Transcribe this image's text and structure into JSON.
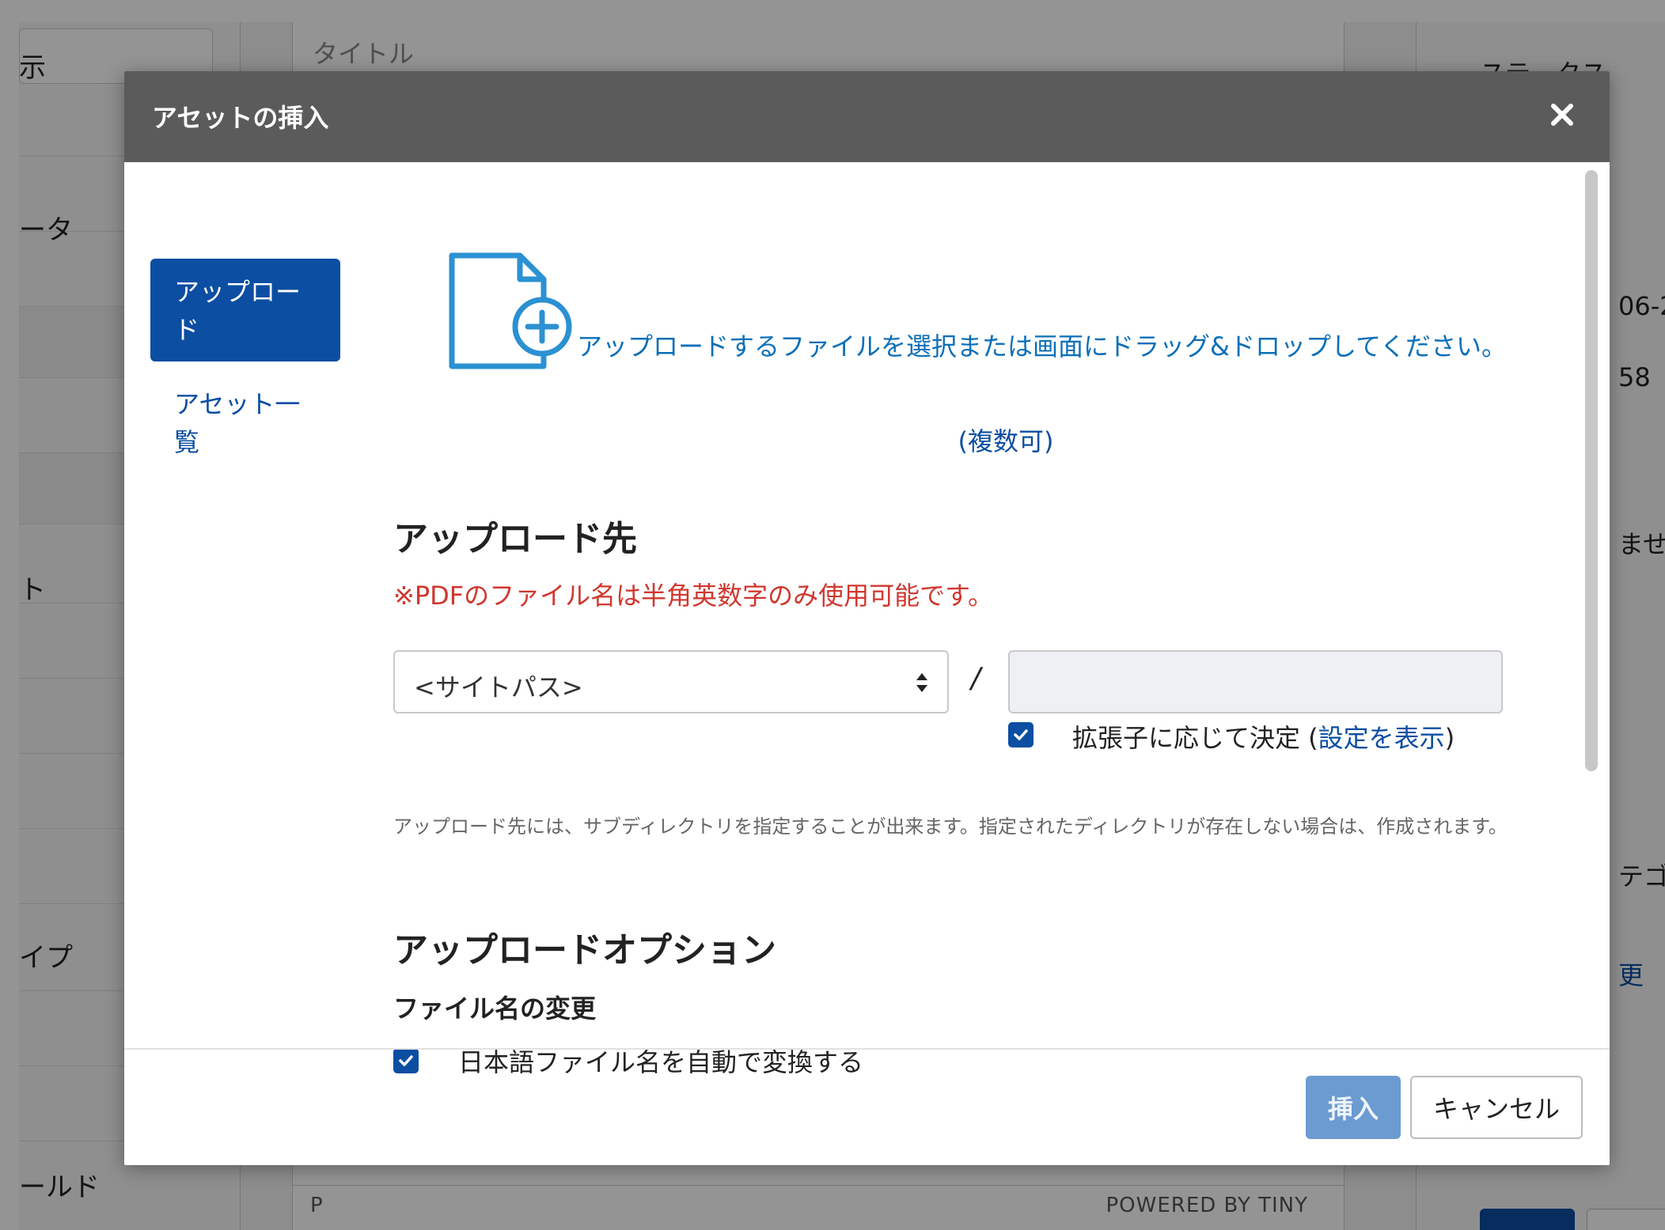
{
  "background": {
    "left_fragments": [
      "示",
      "ータ",
      "ト",
      "イプ",
      "ールド"
    ],
    "title_placeholder": "タイトル",
    "status_tag": "P",
    "powered_by": "POWERED BY TINY",
    "right_fragments": [
      "ステータス",
      "06-2",
      "58",
      "ませ",
      "テゴ",
      "更"
    ]
  },
  "modal": {
    "title": "アセットの挿入",
    "close_icon": "close-icon",
    "side_nav": {
      "upload_label": "アップロード",
      "asset_list_label": "アセット一覧"
    },
    "drop_zone": {
      "icon": "file-add-icon",
      "text": "アップロードするファイルを選択または画面にドラッグ&ドロップしてください。",
      "multiple_note": "(複数可)"
    },
    "destination": {
      "heading": "アップロード先",
      "pdf_warning": "※PDFのファイル名は半角英数字のみ使用可能です。",
      "site_path_value": "<サイトパス>",
      "separator": "/",
      "subdir_value": "",
      "ext_checkbox_checked": true,
      "ext_label_prefix": "拡張子に応じて決定 (",
      "ext_settings_link": "設定を表示",
      "ext_label_suffix": ")",
      "help_text": "アップロード先には、サブディレクトリを指定することが出来ます。指定されたディレクトリが存在しない場合は、作成されます。"
    },
    "options": {
      "heading": "アップロードオプション",
      "rename_heading": "ファイル名の変更",
      "auto_convert_checked": true,
      "auto_convert_label": "日本語ファイル名を自動で変換する"
    },
    "footer": {
      "insert_label": "挿入",
      "cancel_label": "キャンセル"
    }
  },
  "colors": {
    "primary": "#0b4ea2",
    "link": "#0b6fb8",
    "warning": "#d0372e",
    "header_bg": "#5b5b5b",
    "insert_disabled": "#6b9bd0"
  }
}
